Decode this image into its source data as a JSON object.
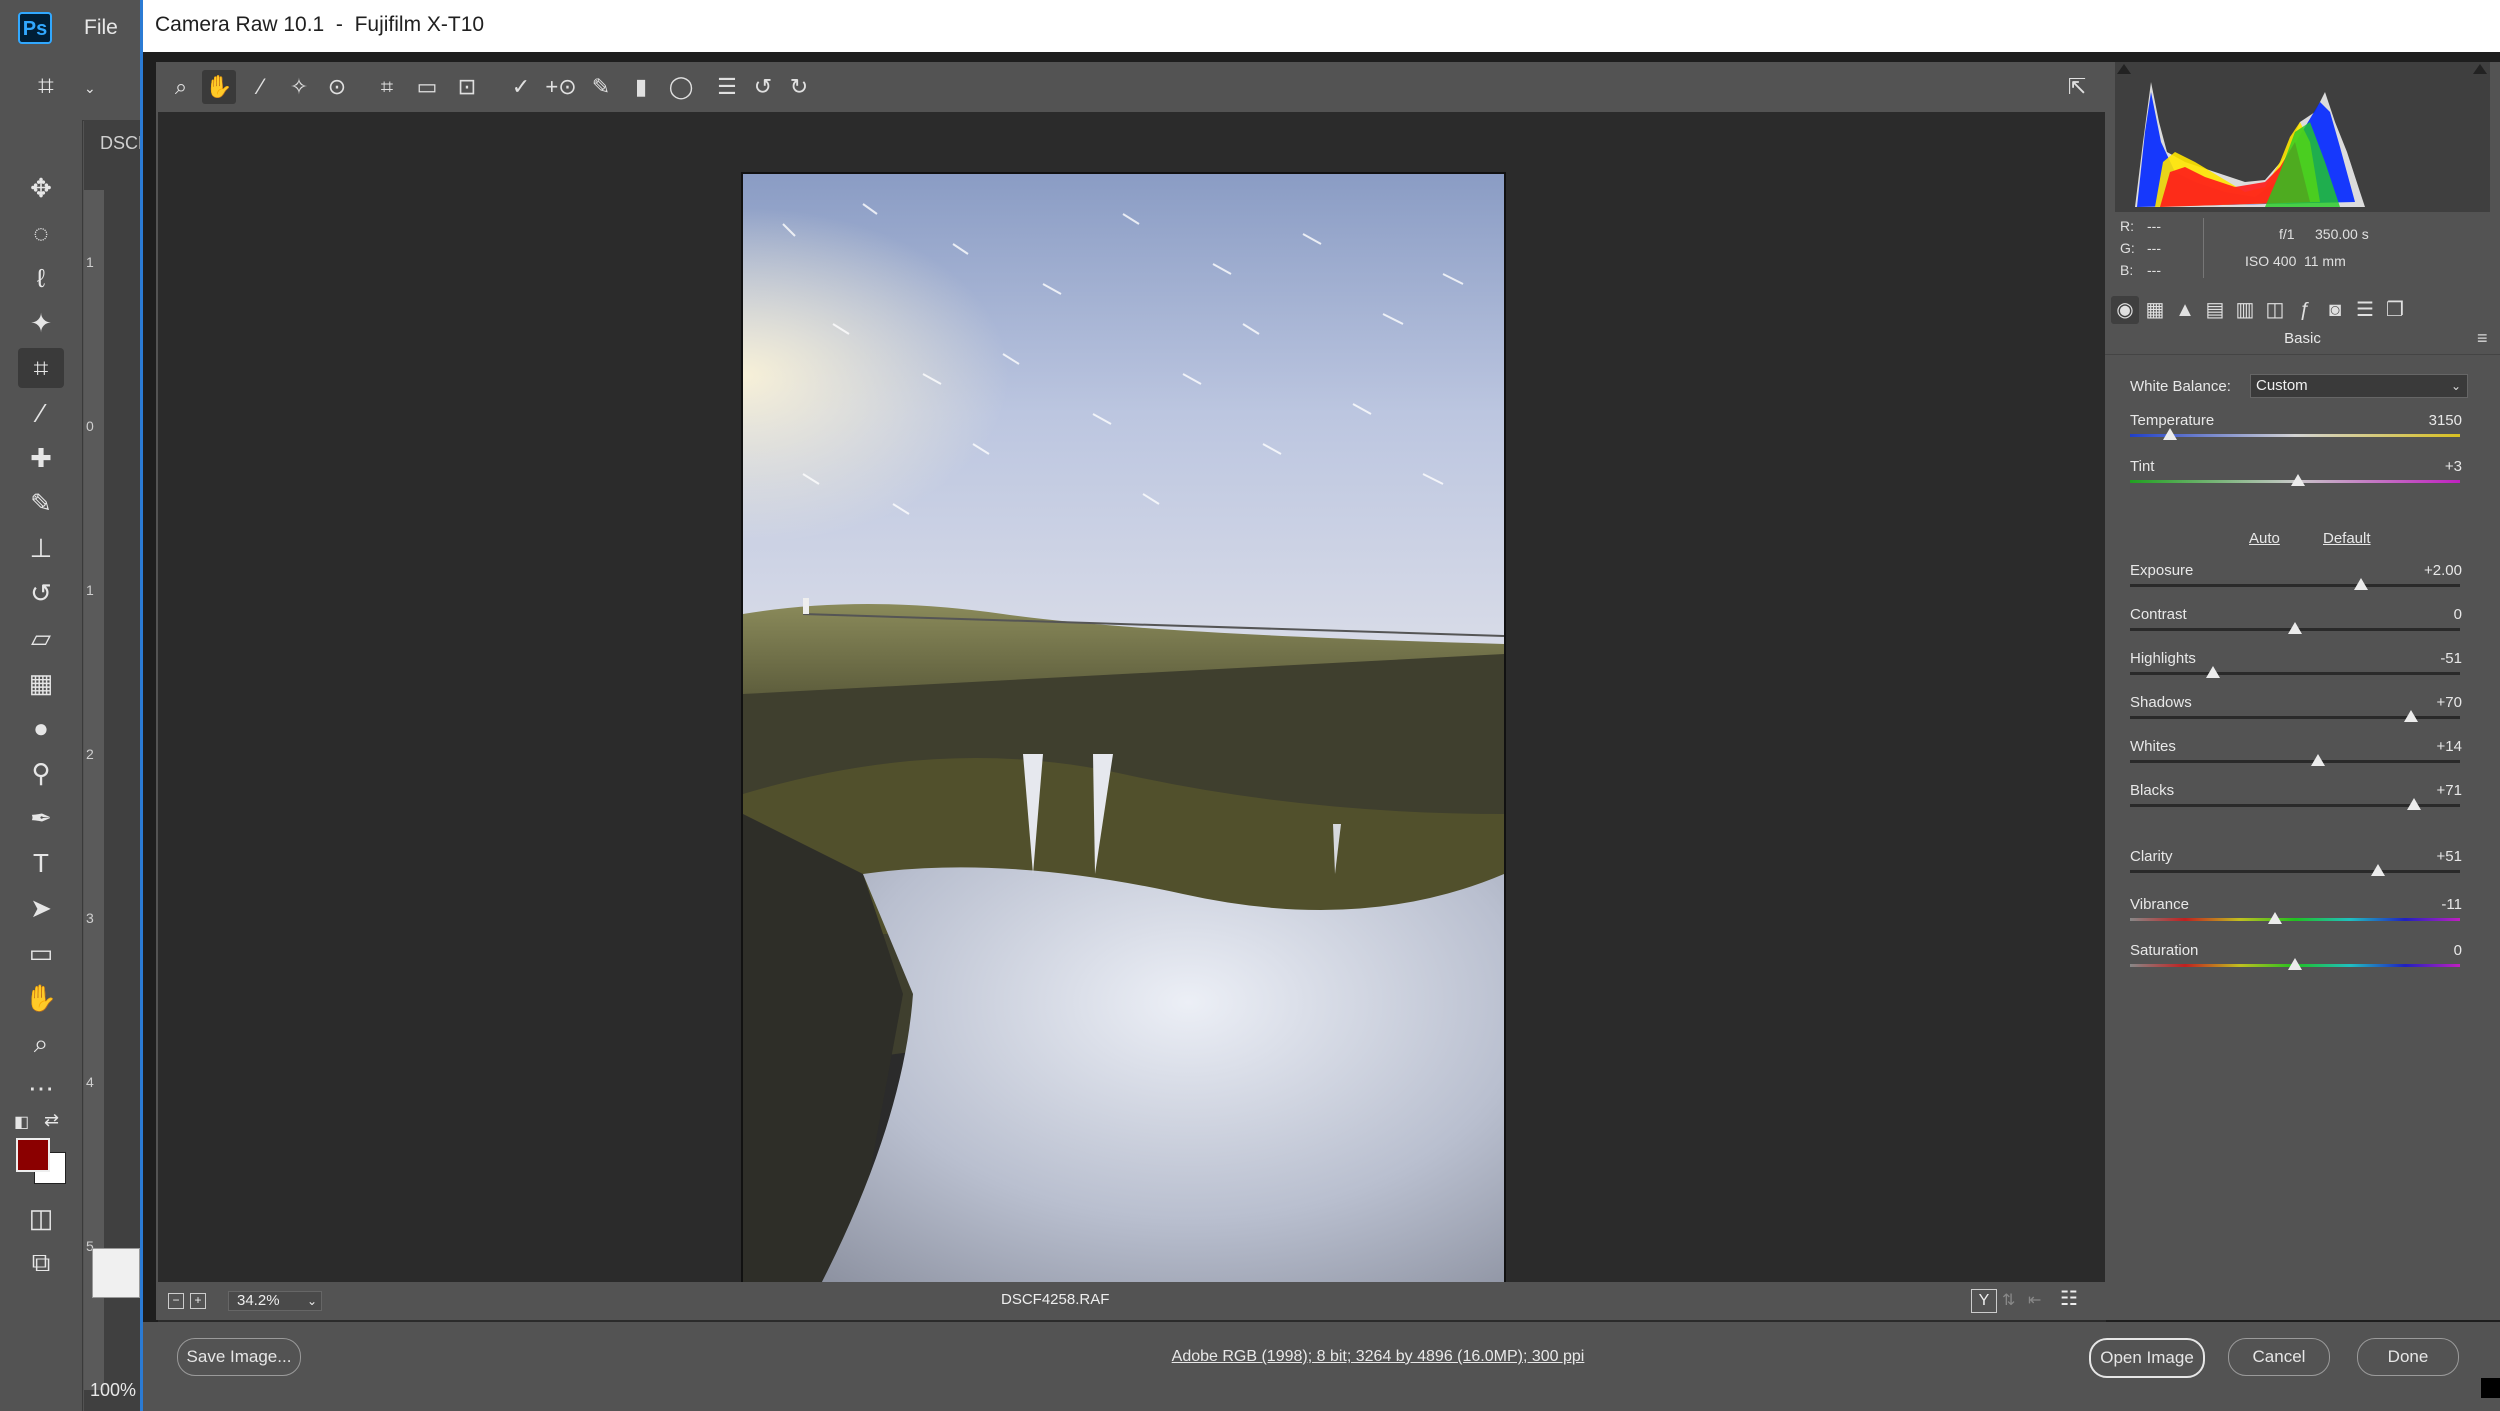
{
  "photoshop": {
    "menu_file": "File",
    "logo": "Ps",
    "doc_tab": "DSCF",
    "zoom": "100%",
    "ruler_ticks": [
      "1",
      "0",
      "1",
      "2",
      "3",
      "4",
      "5"
    ],
    "colors": {
      "foreground": "#8b0000",
      "background": "#ffffff"
    }
  },
  "camera_raw": {
    "title": "Camera Raw 10.1  -  Fujifilm X-T10",
    "toolbar_icons": [
      "zoom-tool-icon",
      "hand-tool-icon",
      "white-balance-tool-icon",
      "color-sampler-icon",
      "targeted-adjustment-icon",
      "crop-tool-icon",
      "straighten-tool-icon",
      "transform-tool-icon",
      "spot-removal-icon",
      "red-eye-icon",
      "adjustment-brush-icon",
      "graduated-filter-icon",
      "radial-filter-icon",
      "preferences-list-icon",
      "rotate-left-icon",
      "rotate-right-icon"
    ],
    "filename": "DSCF4258.RAF",
    "zoom_level": "34.2%",
    "workflow_link": "Adobe RGB (1998); 8 bit; 3264 by 4896 (16.0MP); 300 ppi",
    "buttons": {
      "save": "Save Image...",
      "open": "Open Image",
      "cancel": "Cancel",
      "done": "Done"
    },
    "info": {
      "r_label": "R:",
      "r_value": "---",
      "g_label": "G:",
      "g_value": "---",
      "b_label": "B:",
      "b_value": "---",
      "aperture": "f/1",
      "shutter": "350.00 s",
      "iso": "ISO 400",
      "focal": "11 mm"
    },
    "panel": {
      "title": "Basic",
      "white_balance_label": "White Balance:",
      "white_balance_value": "Custom",
      "auto": "Auto",
      "default": "Default",
      "sliders": [
        {
          "label": "Temperature",
          "value": "3150",
          "level": 0.12
        },
        {
          "label": "Tint",
          "value": "+3",
          "level": 0.51
        },
        {
          "label": "Exposure",
          "value": "+2.00",
          "level": 0.7
        },
        {
          "label": "Contrast",
          "value": "0",
          "level": 0.5
        },
        {
          "label": "Highlights",
          "value": "-51",
          "level": 0.25
        },
        {
          "label": "Shadows",
          "value": "+70",
          "level": 0.85
        },
        {
          "label": "Whites",
          "value": "+14",
          "level": 0.57
        },
        {
          "label": "Blacks",
          "value": "+71",
          "level": 0.86
        },
        {
          "label": "Clarity",
          "value": "+51",
          "level": 0.75
        },
        {
          "label": "Vibrance",
          "value": "-11",
          "level": 0.44
        },
        {
          "label": "Saturation",
          "value": "0",
          "level": 0.5
        }
      ]
    }
  }
}
